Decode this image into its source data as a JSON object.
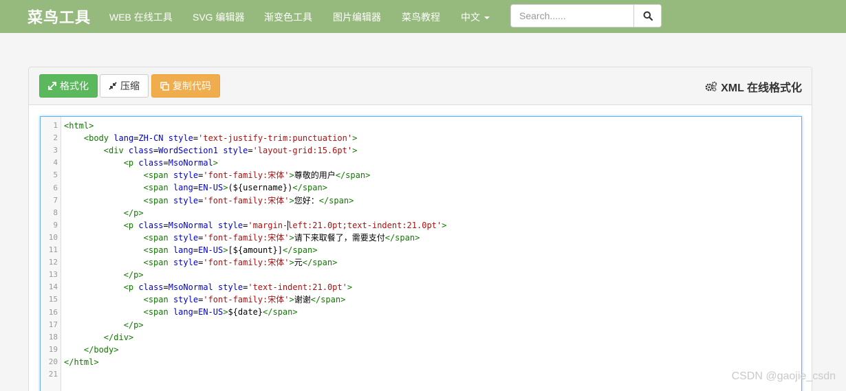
{
  "nav": {
    "brand": "菜鸟工具",
    "items": [
      "WEB 在线工具",
      "SVG 编辑器",
      "渐变色工具",
      "图片编辑器",
      "菜鸟教程",
      "中文"
    ],
    "search_placeholder": "Search......"
  },
  "toolbar": {
    "format_label": "格式化",
    "compress_label": "压缩",
    "copy_label": "复制代码",
    "title": "XML 在线格式化"
  },
  "colors": {
    "navbar": "#96b97d",
    "format_button": "#5cb85c",
    "copy_button": "#f0ad4e",
    "editor_focus": "#66afe9"
  },
  "editor": {
    "line_numbers": [
      "1",
      "2",
      "3",
      "4",
      "5",
      "6",
      "7",
      "8",
      "9",
      "10",
      "11",
      "12",
      "13",
      "14",
      "15",
      "16",
      "17",
      "18",
      "19",
      "20",
      "21"
    ],
    "lines": [
      [
        {
          "c": "t",
          "v": "<html>"
        }
      ],
      [
        {
          "c": "x",
          "v": "    "
        },
        {
          "c": "t",
          "v": "<body "
        },
        {
          "c": "a",
          "v": "lang"
        },
        {
          "c": "x",
          "v": "="
        },
        {
          "c": "a",
          "v": "ZH-CN "
        },
        {
          "c": "a",
          "v": "style"
        },
        {
          "c": "x",
          "v": "="
        },
        {
          "c": "s",
          "v": "'text-justify-trim:punctuation'"
        },
        {
          "c": "t",
          "v": ">"
        }
      ],
      [
        {
          "c": "x",
          "v": "        "
        },
        {
          "c": "t",
          "v": "<div "
        },
        {
          "c": "a",
          "v": "class"
        },
        {
          "c": "x",
          "v": "="
        },
        {
          "c": "a",
          "v": "WordSection1 "
        },
        {
          "c": "a",
          "v": "style"
        },
        {
          "c": "x",
          "v": "="
        },
        {
          "c": "s",
          "v": "'layout-grid:15.6pt'"
        },
        {
          "c": "t",
          "v": ">"
        }
      ],
      [
        {
          "c": "x",
          "v": "            "
        },
        {
          "c": "t",
          "v": "<p "
        },
        {
          "c": "a",
          "v": "class"
        },
        {
          "c": "x",
          "v": "="
        },
        {
          "c": "a",
          "v": "MsoNormal"
        },
        {
          "c": "t",
          "v": ">"
        }
      ],
      [
        {
          "c": "x",
          "v": "                "
        },
        {
          "c": "t",
          "v": "<span "
        },
        {
          "c": "a",
          "v": "style"
        },
        {
          "c": "x",
          "v": "="
        },
        {
          "c": "s",
          "v": "'font-family:宋体'"
        },
        {
          "c": "t",
          "v": ">"
        },
        {
          "c": "x",
          "v": "尊敬的用户"
        },
        {
          "c": "t",
          "v": "</span>"
        }
      ],
      [
        {
          "c": "x",
          "v": "                "
        },
        {
          "c": "t",
          "v": "<span "
        },
        {
          "c": "a",
          "v": "lang"
        },
        {
          "c": "x",
          "v": "="
        },
        {
          "c": "a",
          "v": "EN-US"
        },
        {
          "c": "t",
          "v": ">"
        },
        {
          "c": "x",
          "v": "(${username})"
        },
        {
          "c": "t",
          "v": "</span>"
        }
      ],
      [
        {
          "c": "x",
          "v": "                "
        },
        {
          "c": "t",
          "v": "<span "
        },
        {
          "c": "a",
          "v": "style"
        },
        {
          "c": "x",
          "v": "="
        },
        {
          "c": "s",
          "v": "'font-family:宋体'"
        },
        {
          "c": "t",
          "v": ">"
        },
        {
          "c": "x",
          "v": "您好："
        },
        {
          "c": "t",
          "v": "</span>"
        }
      ],
      [
        {
          "c": "x",
          "v": "            "
        },
        {
          "c": "t",
          "v": "</p>"
        }
      ],
      [
        {
          "c": "x",
          "v": "            "
        },
        {
          "c": "t",
          "v": "<p "
        },
        {
          "c": "a",
          "v": "class"
        },
        {
          "c": "x",
          "v": "="
        },
        {
          "c": "a",
          "v": "MsoNormal "
        },
        {
          "c": "a",
          "v": "style"
        },
        {
          "c": "x",
          "v": "="
        },
        {
          "c": "s",
          "v": "'margin-"
        },
        {
          "c": "cursor",
          "v": ""
        },
        {
          "c": "s",
          "v": "left:21.0pt;text-indent:21.0pt'"
        },
        {
          "c": "t",
          "v": ">"
        }
      ],
      [
        {
          "c": "x",
          "v": "                "
        },
        {
          "c": "t",
          "v": "<span "
        },
        {
          "c": "a",
          "v": "style"
        },
        {
          "c": "x",
          "v": "="
        },
        {
          "c": "s",
          "v": "'font-family:宋体'"
        },
        {
          "c": "t",
          "v": ">"
        },
        {
          "c": "x",
          "v": "请下来取餐了，需要支付"
        },
        {
          "c": "t",
          "v": "</span>"
        }
      ],
      [
        {
          "c": "x",
          "v": "                "
        },
        {
          "c": "t",
          "v": "<span "
        },
        {
          "c": "a",
          "v": "lang"
        },
        {
          "c": "x",
          "v": "="
        },
        {
          "c": "a",
          "v": "EN-US"
        },
        {
          "c": "t",
          "v": ">"
        },
        {
          "c": "x",
          "v": "[${amount}]"
        },
        {
          "c": "t",
          "v": "</span>"
        }
      ],
      [
        {
          "c": "x",
          "v": "                "
        },
        {
          "c": "t",
          "v": "<span "
        },
        {
          "c": "a",
          "v": "style"
        },
        {
          "c": "x",
          "v": "="
        },
        {
          "c": "s",
          "v": "'font-family:宋体'"
        },
        {
          "c": "t",
          "v": ">"
        },
        {
          "c": "x",
          "v": "元"
        },
        {
          "c": "t",
          "v": "</span>"
        }
      ],
      [
        {
          "c": "x",
          "v": "            "
        },
        {
          "c": "t",
          "v": "</p>"
        }
      ],
      [
        {
          "c": "x",
          "v": "            "
        },
        {
          "c": "t",
          "v": "<p "
        },
        {
          "c": "a",
          "v": "class"
        },
        {
          "c": "x",
          "v": "="
        },
        {
          "c": "a",
          "v": "MsoNormal "
        },
        {
          "c": "a",
          "v": "style"
        },
        {
          "c": "x",
          "v": "="
        },
        {
          "c": "s",
          "v": "'text-indent:21.0pt'"
        },
        {
          "c": "t",
          "v": ">"
        }
      ],
      [
        {
          "c": "x",
          "v": "                "
        },
        {
          "c": "t",
          "v": "<span "
        },
        {
          "c": "a",
          "v": "style"
        },
        {
          "c": "x",
          "v": "="
        },
        {
          "c": "s",
          "v": "'font-family:宋体'"
        },
        {
          "c": "t",
          "v": ">"
        },
        {
          "c": "x",
          "v": "谢谢"
        },
        {
          "c": "t",
          "v": "</span>"
        }
      ],
      [
        {
          "c": "x",
          "v": "                "
        },
        {
          "c": "t",
          "v": "<span "
        },
        {
          "c": "a",
          "v": "lang"
        },
        {
          "c": "x",
          "v": "="
        },
        {
          "c": "a",
          "v": "EN-US"
        },
        {
          "c": "t",
          "v": ">"
        },
        {
          "c": "x",
          "v": "${date}"
        },
        {
          "c": "t",
          "v": "</span>"
        }
      ],
      [
        {
          "c": "x",
          "v": "            "
        },
        {
          "c": "t",
          "v": "</p>"
        }
      ],
      [
        {
          "c": "x",
          "v": "        "
        },
        {
          "c": "t",
          "v": "</div>"
        }
      ],
      [
        {
          "c": "x",
          "v": "    "
        },
        {
          "c": "t",
          "v": "</body>"
        }
      ],
      [
        {
          "c": "t",
          "v": "</html>"
        }
      ],
      []
    ]
  },
  "watermark": "CSDN @gaojie_csdn"
}
